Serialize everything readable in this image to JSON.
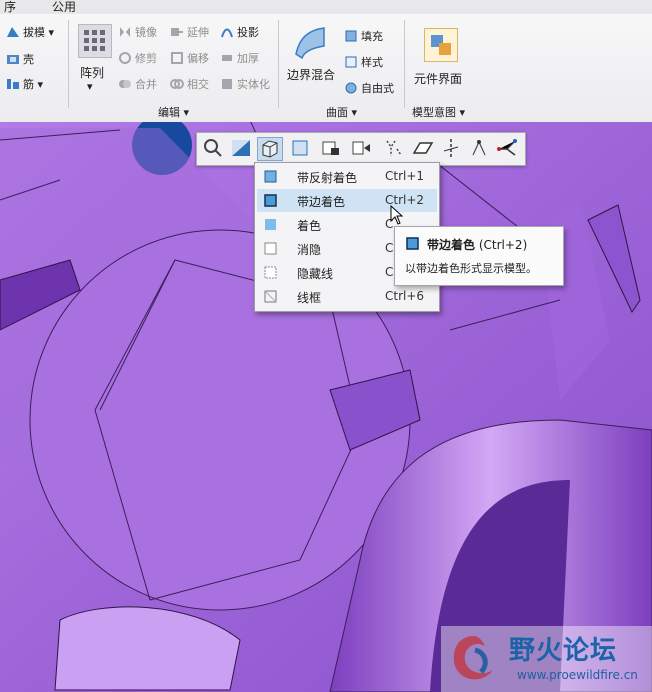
{
  "ribbon_tabs": [
    "序",
    "公用"
  ],
  "ribbon": {
    "col1": [
      "拔模",
      "壳",
      "筋"
    ],
    "array_label": "阵列",
    "edit_tools": [
      "镜像",
      "延伸",
      "投影",
      "修剪",
      "偏移",
      "加厚",
      "合并",
      "相交",
      "实体化"
    ],
    "boundary_blend": "边界混合",
    "surface_tools": [
      "填充",
      "样式",
      "自由式"
    ],
    "element_interface": "元件界面",
    "groups": {
      "edit": "编辑",
      "surface": "曲面",
      "model_intent": "模型意图"
    }
  },
  "toolbar": {
    "icons": [
      "zoom-icon",
      "refit-icon",
      "display-style-icon",
      "saved-views-icon",
      "view-manager-icon",
      "perspective-icon",
      "annotation-display-icon",
      "plane-display-icon",
      "axis-display-icon",
      "point-display-icon",
      "csys-display-icon"
    ]
  },
  "display_menu": {
    "items": [
      {
        "label": "带反射着色",
        "shortcut": "Ctrl+1"
      },
      {
        "label": "带边着色",
        "shortcut": "Ctrl+2"
      },
      {
        "label": "着色",
        "shortcut": "C"
      },
      {
        "label": "消隐",
        "shortcut": "C"
      },
      {
        "label": "隐藏线",
        "shortcut": "C"
      },
      {
        "label": "线框",
        "shortcut": "Ctrl+6"
      }
    ],
    "selected_index": 1
  },
  "tooltip": {
    "title": "带边着色",
    "shortcut": "(Ctrl+2)",
    "description": "以带边着色形式显示模型。"
  },
  "watermark": {
    "title": "野火论坛",
    "url": "www.proewildfire.cn"
  },
  "colors": {
    "model": "#9b5fd6",
    "highlight": "#cfe3f5",
    "ribbon": "#f4f4f6",
    "brand": "#1c63a8"
  }
}
